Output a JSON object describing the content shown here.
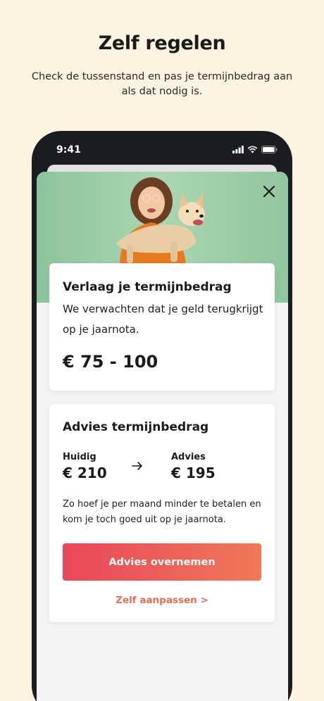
{
  "promo": {
    "title": "Zelf regelen",
    "subtitle": "Check de tussenstand en pas je termijnbedrag aan als dat nodig is."
  },
  "status_bar": {
    "time": "9:41",
    "icons": [
      "signal-icon",
      "wifi-icon",
      "battery-icon"
    ]
  },
  "hero": {
    "image": "girl-holding-dog-photo",
    "background_color": "#a6d4ae",
    "close_icon": "close-icon"
  },
  "estimate_card": {
    "title": "Verlaag je termijnbedrag",
    "text": "We verwachten dat je geld terugkrijgt op je jaarnota.",
    "amount": "€ 75 - 100"
  },
  "advice_card": {
    "title": "Advies termijnbedrag",
    "current_label": "Huidig",
    "current_value": "€ 210",
    "advice_label": "Advies",
    "advice_value": "€ 195",
    "arrow_icon": "arrow-right-icon",
    "text": "Zo hoef je per maand minder te betalen en kom je toch goed uit op je jaarnota.",
    "primary_button": "Advies overnemen",
    "link": "Zelf aanpassen >"
  },
  "colors": {
    "page_background": "#fdf3e1",
    "accent_gradient_start": "#e9475a",
    "accent_gradient_end": "#f07857",
    "link_color": "#ec6b52"
  }
}
